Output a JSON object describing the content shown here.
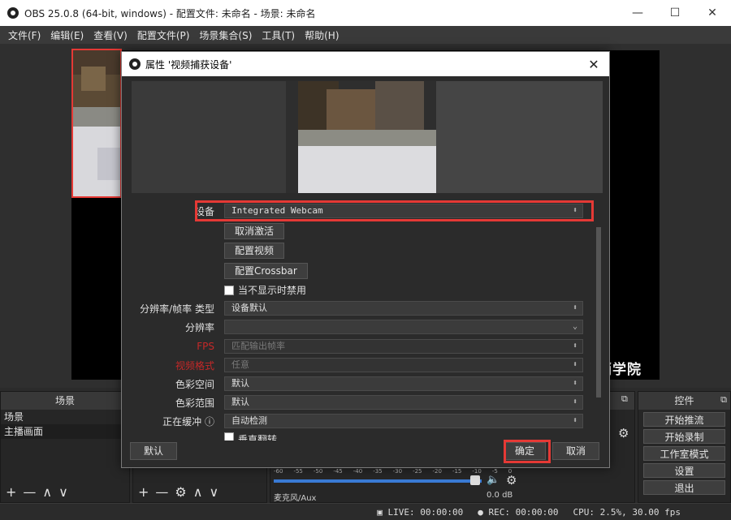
{
  "window": {
    "title": "OBS 25.0.8 (64-bit, windows) - 配置文件: 未命名 - 场景: 未命名",
    "controls": [
      "—",
      "☐",
      "✕"
    ]
  },
  "menu": [
    "文件(F)",
    "编辑(E)",
    "查看(V)",
    "配置文件(P)",
    "场景集合(S)",
    "工具(T)",
    "帮助(H)"
  ],
  "scenes_panel": {
    "header": "场景",
    "items": [
      "场景",
      "主播画面"
    ],
    "toolbar": [
      "+",
      "—",
      "∧",
      "∨"
    ]
  },
  "sources_panel": {
    "toolbar": [
      "+",
      "—",
      "⚙",
      "∧",
      "∨"
    ]
  },
  "mixer_panel": {
    "scale_labels": [
      "-60",
      "-55",
      "-50",
      "-45",
      "-40",
      "-35",
      "-30",
      "-25",
      "-20",
      "-15",
      "-10",
      "-5",
      "0"
    ],
    "track_label": "麦克风/Aux",
    "level_db": "0.0 dB"
  },
  "controls_panel": {
    "header": "控件",
    "buttons": [
      "开始推流",
      "开始录制",
      "工作室模式",
      "设置",
      "退出"
    ]
  },
  "status": {
    "live": "LIVE: 00:00:00",
    "rec": "REC: 00:00:00",
    "cpu": "CPU: 2.5%, 30.00 fps"
  },
  "dialog": {
    "title": "属性 '视频捕获设备'",
    "close": "✕",
    "device_label": "设备",
    "device_value": "Integrated Webcam",
    "deactivate_button": "取消激活",
    "config_video_button": "配置视频",
    "config_crossbar_button": "配置Crossbar",
    "hide_checkbox_label": "当不显示时禁用",
    "hide_checkbox_checked": false,
    "resolution_type_label": "分辨率/帧率 类型",
    "resolution_type_value": "设备默认",
    "resolution_label": "分辨率",
    "resolution_value": "",
    "fps_label": "FPS",
    "fps_value": "匹配输出帧率",
    "video_format_label": "视频格式",
    "video_format_value": "任意",
    "color_space_label": "色彩空间",
    "color_space_value": "默认",
    "color_range_label": "色彩范围",
    "color_range_value": "默认",
    "buffering_label": "正在缓冲",
    "buffering_value": "自动检测",
    "flip_label": "垂直翻转",
    "defaults_button": "默认",
    "ok_button": "确定",
    "cancel_button": "取消"
  },
  "watermark": "蓝鲸数字营销学院",
  "colors": {
    "highlight": "#e53935",
    "disabled_label": "#c62828",
    "dark_bg": "#2b2b2b"
  }
}
